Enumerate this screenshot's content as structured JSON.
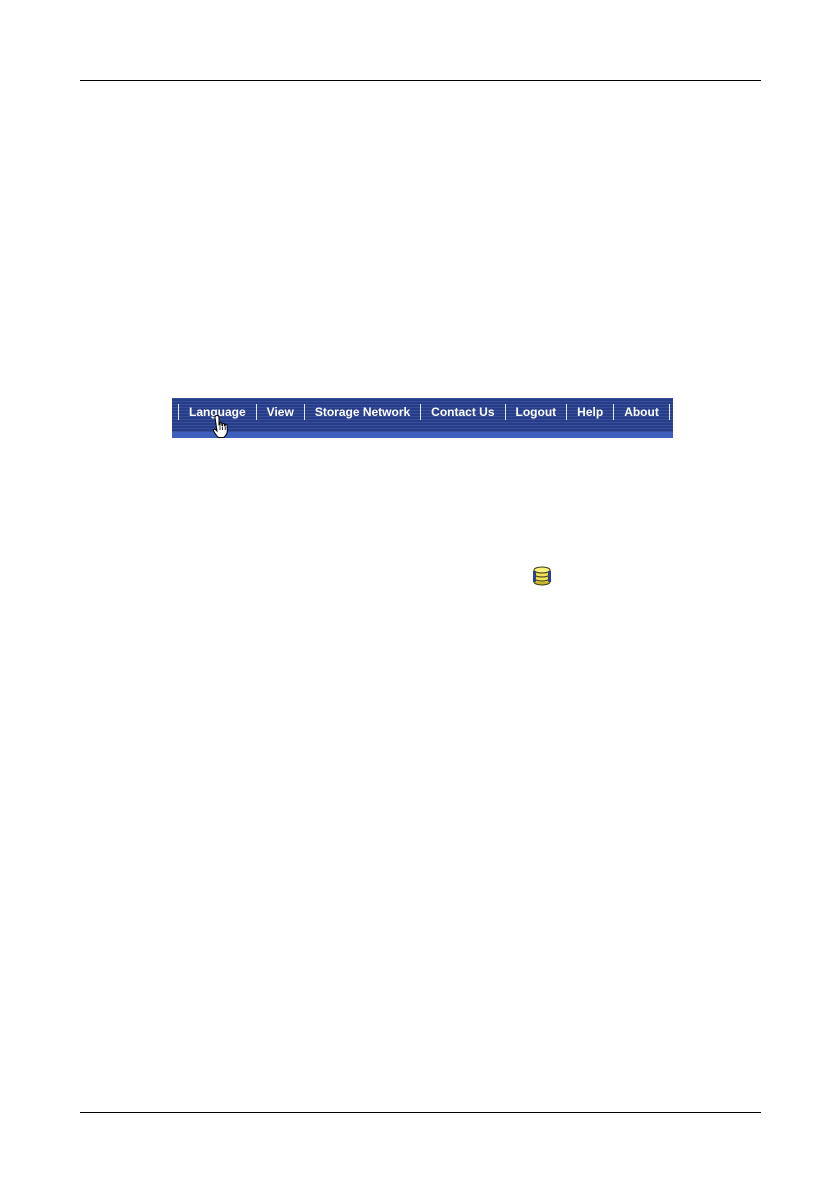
{
  "menubar": {
    "items": [
      {
        "label": "Language"
      },
      {
        "label": "View"
      },
      {
        "label": "Storage Network"
      },
      {
        "label": "Contact Us"
      },
      {
        "label": "Logout"
      },
      {
        "label": "Help"
      },
      {
        "label": "About"
      }
    ],
    "colors": {
      "background": "#2b4496",
      "text": "#ffffff"
    }
  },
  "icons": {
    "cursor": "hand-pointer-icon",
    "storage": "database-stack-icon"
  }
}
